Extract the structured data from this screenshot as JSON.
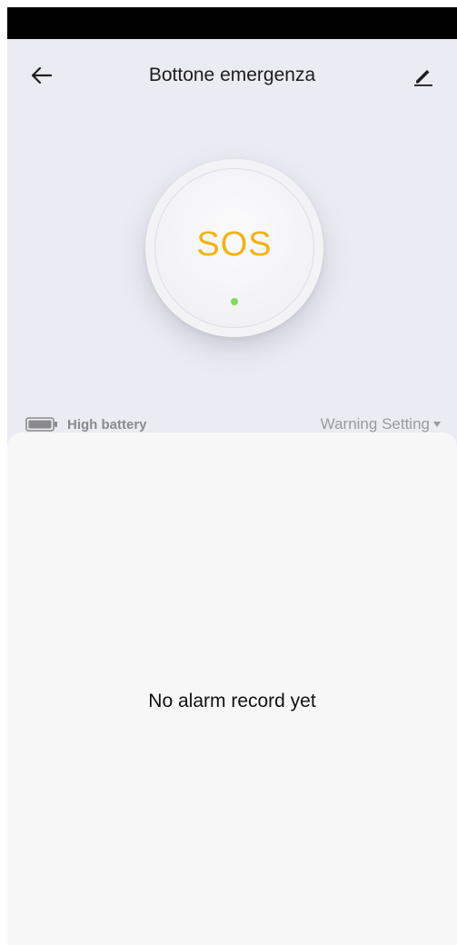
{
  "header": {
    "title": "Bottone emergenza",
    "back_icon": "arrow-left-icon",
    "edit_icon": "pencil-icon"
  },
  "device": {
    "button_label": "SOS",
    "led_color": "#7ddc5c",
    "label_color": "#f2b311"
  },
  "status": {
    "battery_icon": "battery-full-icon",
    "battery_label": "High battery",
    "warning_setting_label": "Warning Setting",
    "dropdown_icon": "caret-down-icon"
  },
  "records": {
    "empty_message": "No alarm record yet"
  },
  "colors": {
    "background": "#ebebf3",
    "panel": "#f7f7f7",
    "status_bar": "#000000"
  }
}
